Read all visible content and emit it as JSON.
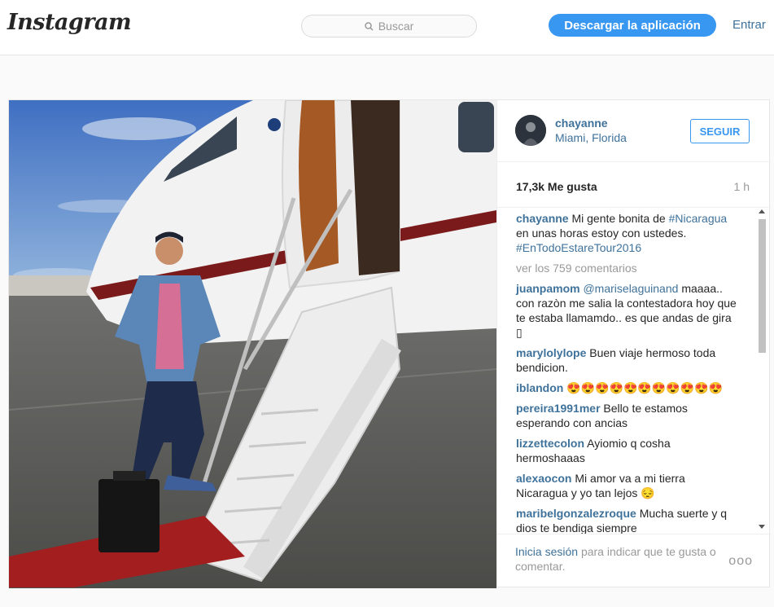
{
  "header": {
    "logo": "Instagram",
    "search_placeholder": "Buscar",
    "download_label": "Descargar la aplicación",
    "login_label": "Entrar"
  },
  "post": {
    "username": "chayanne",
    "location": "Miami, Florida",
    "follow_label": "SEGUIR",
    "likes": "17,3k Me gusta",
    "time": "1 h",
    "caption_user": "chayanne",
    "caption_text": "Mi gente bonita de",
    "caption_tag1": "#Nicaragua",
    "caption_text2": "en unas horas estoy con ustedes.",
    "caption_tag2": "#EnTodoEstareTour2016",
    "more_comments": "ver los 759 comentarios",
    "comments": [
      {
        "user": "juanpamom",
        "mention": "@mariselaguinand",
        "text": "maaaa.. con razòn me salia la contestadora hoy que te estaba llamamdo.. es que andas de gira ▯"
      },
      {
        "user": "marylolylope",
        "text": "Buen viaje hermoso toda bendicion."
      },
      {
        "user": "iblandon",
        "text": "😍😍😍😍😍😍😍😍😍😍😍"
      },
      {
        "user": "pereira1991mer",
        "text": "Bello te estamos esperando con ancias"
      },
      {
        "user": "lizzettecolon",
        "text": "Ayiomio q cosha hermoshaaas"
      },
      {
        "user": "alexaocon",
        "text": "Mi amor va a mi tierra Nicaragua y yo tan lejos 😔"
      },
      {
        "user": "maribelgonzalezroque",
        "text": "Mucha suerte y q dios te bendiga siempre"
      }
    ],
    "login_link": "Inicia sesión",
    "login_hint": "para indicar que te gusta o comentar.",
    "more_options": "ooo"
  }
}
